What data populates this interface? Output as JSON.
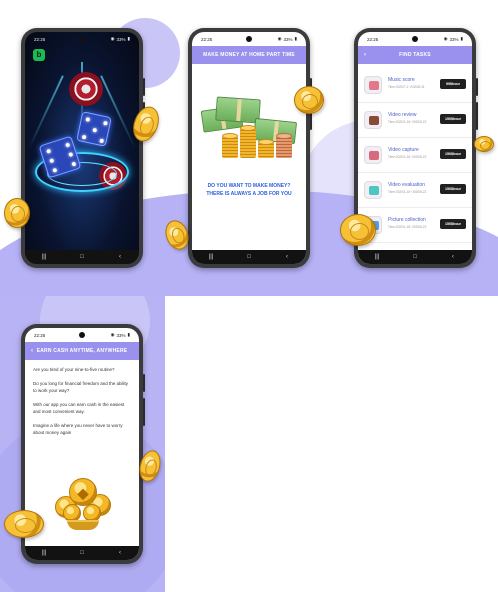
{
  "status": {
    "time": "22:25",
    "battery": "33%"
  },
  "screen2": {
    "header": "MAKE MONEY AT HOME PART TIME",
    "question_line1": "DO YOU WANT TO MAKE MONEY?",
    "question_line2": "THERE IS ALWAYS A JOB FOR YOU"
  },
  "screen3": {
    "header": "FIND TASKS",
    "tasks": [
      {
        "name": "Music score",
        "time": "Time:2020/7-1~2020/8-31",
        "button": "99$hour",
        "icon": "music-card-icon"
      },
      {
        "name": "Video review",
        "time": "Time:2020/1-16~2020/8-22",
        "button": "150$hour",
        "icon": "tv-icon"
      },
      {
        "name": "Video capture",
        "time": "Time:2020/1-16~2020/8-22",
        "button": "150$hour",
        "icon": "video-capture-icon"
      },
      {
        "name": "Video evaluation",
        "time": "Time:2020/1-16~2020/8-22",
        "button": "150$hour",
        "icon": "robot-icon"
      },
      {
        "name": "Picture collection",
        "time": "Time:2020/1-16~2020/8-22",
        "button": "150$hour",
        "icon": "picture-icon"
      }
    ]
  },
  "screen4": {
    "header": "EARN CASH ANYTIME, ANYWHERE",
    "paragraphs": [
      "Are you tired of your nine-to-five routine?",
      "Do you long for financial freedom and the ability to work your way?",
      "With our app you can earn cash in the easiest and most convenient way.",
      "Imagine a life where you never have to worry about money again"
    ]
  },
  "colors": {
    "accent": "#9a91ee",
    "link_blue": "#2b5fd9",
    "background_purple": "#b6b2f5"
  }
}
